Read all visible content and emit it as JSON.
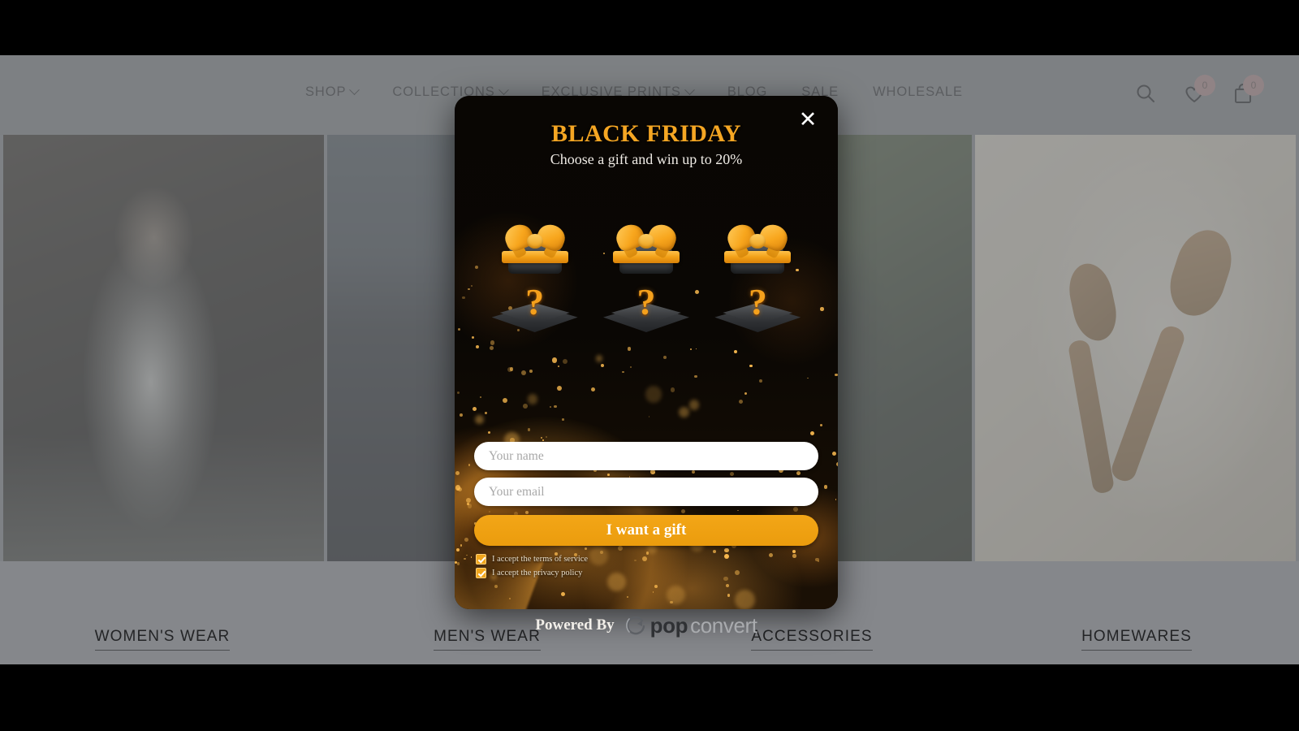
{
  "site": {
    "nav": [
      {
        "label": "SHOP",
        "has_caret": true
      },
      {
        "label": "COLLECTIONS",
        "has_caret": true
      },
      {
        "label": "EXCLUSIVE PRINTS",
        "has_caret": true
      },
      {
        "label": "BLOG",
        "has_caret": false
      },
      {
        "label": "SALE",
        "has_caret": false
      },
      {
        "label": "WHOLESALE",
        "has_caret": false
      }
    ],
    "icons": {
      "search": "search-icon",
      "wishlist": "heart-icon",
      "cart": "shopping-bag-icon"
    },
    "wishlist_count": "0",
    "cart_count": "0",
    "categories": [
      {
        "label": "WOMEN'S WEAR"
      },
      {
        "label": "MEN'S WEAR"
      },
      {
        "label": "ACCESSORIES"
      },
      {
        "label": "HOMEWARES"
      }
    ]
  },
  "modal": {
    "close_icon": "close-icon",
    "title": "BLACK FRIDAY",
    "subtitle": "Choose a gift and win up to 20%",
    "gifts": [
      {
        "label": "?"
      },
      {
        "label": "?"
      },
      {
        "label": "?"
      }
    ],
    "fields": {
      "name_placeholder": "Your name",
      "name_value": "",
      "email_placeholder": "Your email",
      "email_value": ""
    },
    "submit_label": "I want a gift",
    "consents": [
      {
        "label": "I accept the terms of service",
        "checked": true
      },
      {
        "label": "I accept the privacy policy",
        "checked": true
      }
    ],
    "colors": {
      "accent": "#f2a117",
      "title": "#f5a623",
      "button_text": "#ffffff",
      "background": "#0a0704"
    }
  },
  "footer": {
    "powered_label": "Powered By",
    "brand_part_1": "pop",
    "brand_part_2": "convert",
    "brand_icon": "popconvert-arc-icon"
  }
}
